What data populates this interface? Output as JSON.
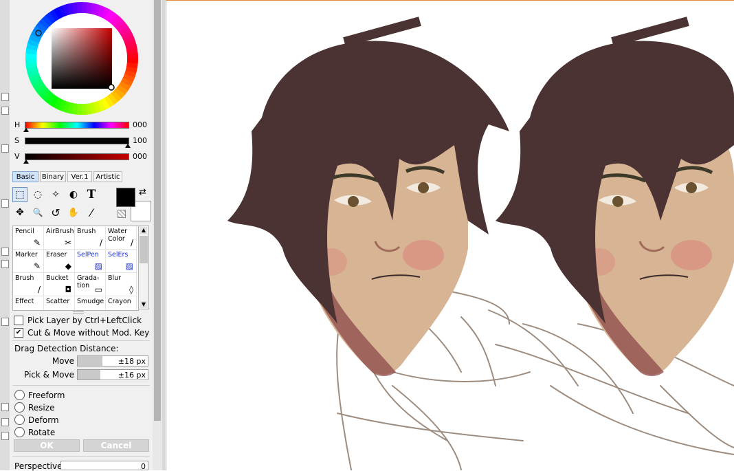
{
  "colors": {
    "accent": "#e08a3a",
    "panel_bg": "#f0f0f0",
    "primary_color": "#000000",
    "secondary_color": "#ffffff",
    "link_blue": "#1c2fd0",
    "hair": "#4a3030",
    "skin": "#d4b08f"
  },
  "color_wheel": {
    "selected_hue_hex": "#c60000"
  },
  "hsv": {
    "h": {
      "label": "H",
      "value": "000"
    },
    "s": {
      "label": "S",
      "value": "100"
    },
    "v": {
      "label": "V",
      "value": "000"
    }
  },
  "tabs": [
    {
      "label": "Basic",
      "active": true
    },
    {
      "label": "Binary",
      "active": false
    },
    {
      "label": "Ver.1",
      "active": false
    },
    {
      "label": "Artistic",
      "active": false
    }
  ],
  "tools": [
    {
      "icon": "rect-select-icon",
      "glyph": "⬚"
    },
    {
      "icon": "lasso-icon",
      "glyph": "◌"
    },
    {
      "icon": "magic-wand-icon",
      "glyph": "✧"
    },
    {
      "icon": "shape-icon",
      "glyph": "◐"
    },
    {
      "icon": "text-tool-icon",
      "glyph": "T"
    },
    {
      "icon": "move-icon",
      "glyph": "✥"
    },
    {
      "icon": "zoom-icon",
      "glyph": "🔍"
    },
    {
      "icon": "rotate-view-icon",
      "glyph": "↺"
    },
    {
      "icon": "hand-icon",
      "glyph": "✋"
    },
    {
      "icon": "eyedropper-icon",
      "glyph": "⁄"
    }
  ],
  "brushes": [
    {
      "label": "Pencil",
      "blue": false,
      "icon": "✎"
    },
    {
      "label": "AirBrush",
      "blue": false,
      "icon": "✂"
    },
    {
      "label": "Brush",
      "blue": false,
      "icon": "/"
    },
    {
      "label": "Water Color",
      "blue": false,
      "icon": "/"
    },
    {
      "label": "Marker",
      "blue": false,
      "icon": "✎"
    },
    {
      "label": "Eraser",
      "blue": false,
      "icon": "◆"
    },
    {
      "label": "SelPen",
      "blue": true,
      "icon": "▨"
    },
    {
      "label": "SelErs",
      "blue": true,
      "icon": "▨"
    },
    {
      "label": "Brush",
      "blue": false,
      "icon": "/"
    },
    {
      "label": "Bucket",
      "blue": false,
      "icon": "◘"
    },
    {
      "label": "Grada- tion",
      "blue": false,
      "icon": "▭"
    },
    {
      "label": "Blur",
      "blue": false,
      "icon": "◊"
    },
    {
      "label": "Effect",
      "blue": false,
      "icon": ""
    },
    {
      "label": "Scatter",
      "blue": false,
      "icon": ""
    },
    {
      "label": "Smudge",
      "blue": false,
      "icon": ""
    },
    {
      "label": "Crayon",
      "blue": false,
      "icon": ""
    }
  ],
  "options": {
    "pick_layer": {
      "label": "Pick Layer by Ctrl+LeftClick",
      "checked": false
    },
    "cut_move": {
      "label": "Cut & Move without Mod. Key",
      "checked": true,
      "mark": "✔"
    },
    "drag_detection_label": "Drag Detection Distance:",
    "move": {
      "label": "Move",
      "value": "±18 px",
      "fraction": 0.35
    },
    "pick_move": {
      "label": "Pick & Move",
      "value": "±16 px",
      "fraction": 0.32
    }
  },
  "transform_modes": [
    "Freeform",
    "Resize",
    "Deform",
    "Rotate"
  ],
  "buttons": {
    "ok": "OK",
    "cancel": "Cancel"
  },
  "perspective": {
    "label": "Perspective",
    "value": "0"
  }
}
